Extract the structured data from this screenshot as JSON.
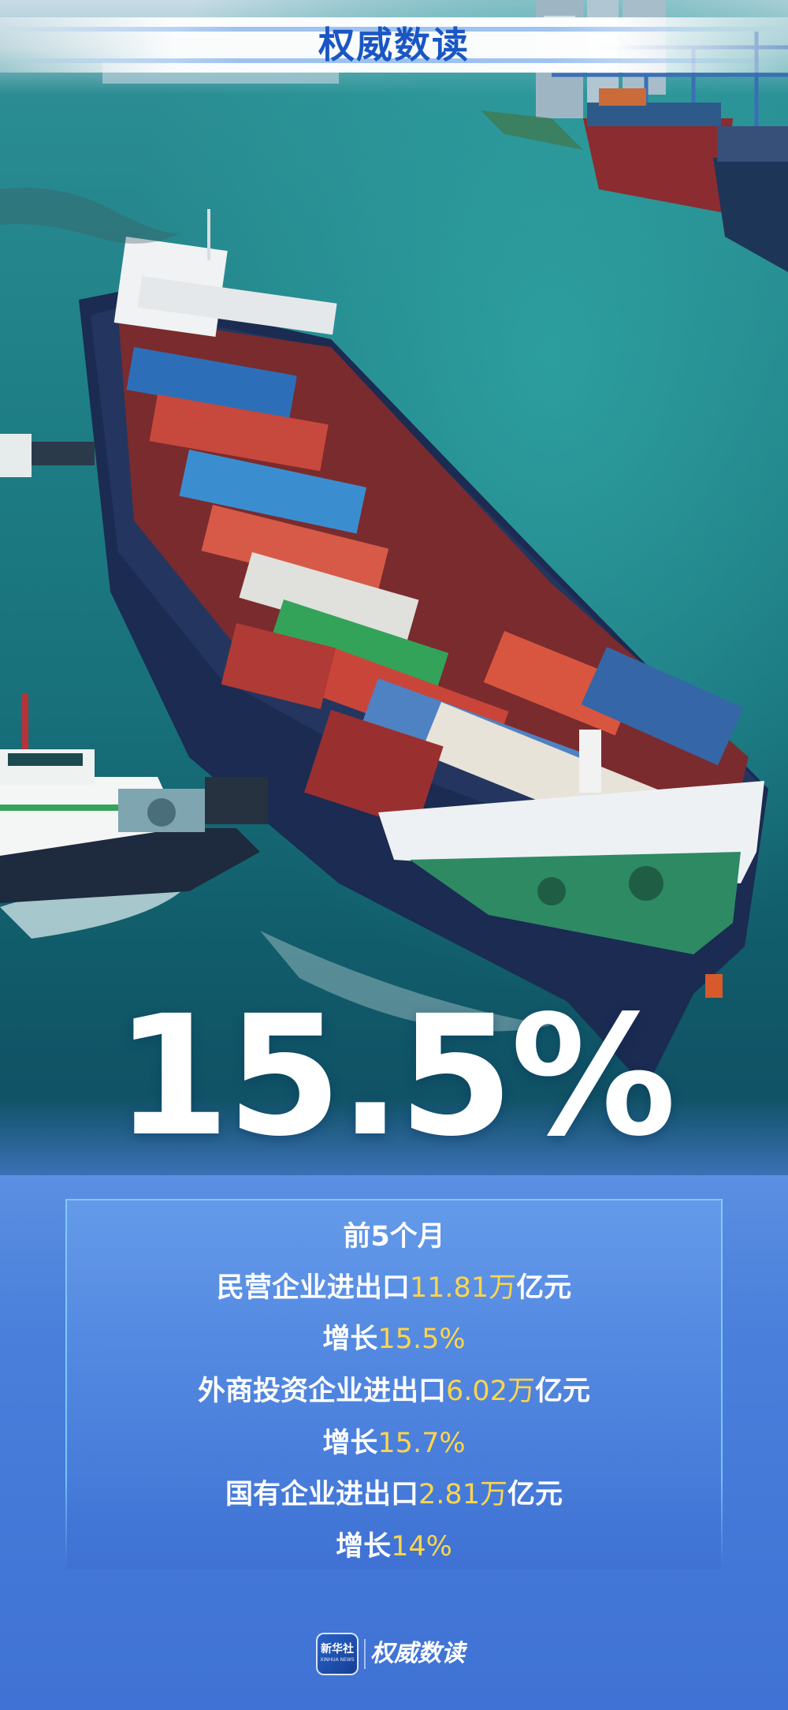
{
  "header": {
    "title": "权威数读"
  },
  "headline": {
    "value": "15.5%"
  },
  "stats": {
    "period": "前5个月",
    "private": {
      "label": "民营企业进出口",
      "amount": "11.81万",
      "unit": "亿元",
      "growth_label": "增长",
      "growth": "15.5%"
    },
    "foreign": {
      "label": "外商投资企业进出口",
      "amount": "6.02万",
      "unit": "亿元",
      "growth_label": "增长",
      "growth": "15.7%"
    },
    "state": {
      "label": "国有企业进出口",
      "amount": "2.81万",
      "unit": "亿元",
      "growth_label": "增长",
      "growth": "14%"
    }
  },
  "footer": {
    "logo_cn": "新华社",
    "logo_en": "XINHUA NEWS",
    "brand": "权威数读"
  },
  "colors": {
    "accent": "#1a56c4",
    "highlight": "#ffd54a",
    "panel": "#3f72d4"
  }
}
